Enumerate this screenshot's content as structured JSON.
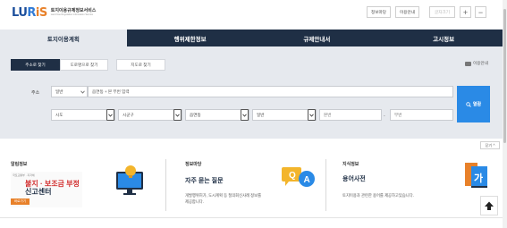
{
  "header": {
    "logo_mark": [
      "LU",
      "R",
      "iS"
    ],
    "logo_title": "토지이용규제정보서비스",
    "logo_subtitle": "Land Use Regulation Information Service",
    "buttons": {
      "recent": "정보마당",
      "guide": "이용안내",
      "zoom": "글자크기",
      "plus": "+",
      "minus": "−"
    }
  },
  "nav": {
    "tabs": [
      "토지이용계획",
      "행위제한정보",
      "규제안내서",
      "고시정보"
    ],
    "active": 0
  },
  "search_panel": {
    "subtabs": [
      "주소로 찾기",
      "도로명으로 찾기",
      "지도로 찾기"
    ],
    "active_subtab": 0,
    "guide_link": "이용안내",
    "address_label": "주소",
    "address_type": "일반",
    "address_input_placeholder": "읍면동 + 본 부번 입력",
    "selects": {
      "sido": "시도",
      "sigungu": "시군구",
      "eupmyeondong": "읍면동",
      "general": "일반",
      "bonbun": "본번",
      "bubun": "부번"
    },
    "dash": "-",
    "search_button": "열람",
    "fold_button": "닫기 ^"
  },
  "cards": {
    "notice": {
      "title": "알림정보",
      "banner_sub": "국토교통부 · 지자체",
      "banner_line1": "불지 · 보조금 부정",
      "banner_line2": "신고센터",
      "banner_button": "바로가기"
    },
    "faq": {
      "title": "정보마당",
      "heading": "자주 묻는 질문",
      "desc_line1": "개발행위허가, 도시계획 등 질의회신사례 정보를",
      "desc_line2": "제공합니다.",
      "icon_q": "Q",
      "icon_a": "A"
    },
    "dictionary": {
      "title": "지식정보",
      "heading": "용어사전",
      "desc": "토지이용과 관련한 용어를 제공하고있습니다.",
      "icon_letter": "가"
    }
  },
  "colors": {
    "nav_bg": "#1f2f45",
    "panel_bg": "#e6e9ee",
    "accent_blue": "#2a8ae6",
    "accent_orange": "#e8812a"
  }
}
